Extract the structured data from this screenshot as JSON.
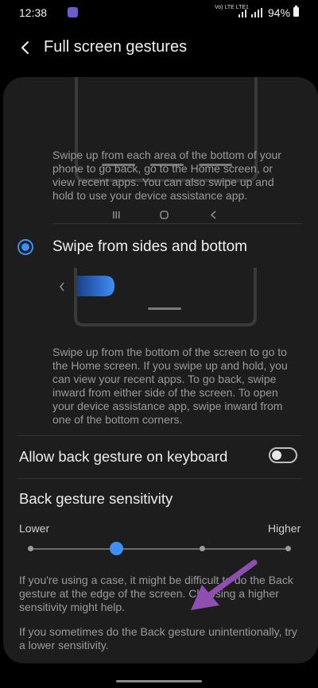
{
  "status_bar": {
    "time": "12:38",
    "network": "Vo) LTE LTE1",
    "battery": "94%"
  },
  "header": {
    "title": "Full screen gestures"
  },
  "option_buttons": {
    "description": "Swipe up from each area of the bottom of your phone to go back, go to the Home screen, or view recent apps. You can also swipe up and hold to use your device assistance app."
  },
  "option_gestures": {
    "label": "Swipe from sides and bottom",
    "selected": true,
    "description": "Swipe up from the bottom of the screen to go to the Home screen. If you swipe up and hold, you can view your recent apps. To go back, swipe inward from either side of the screen. To open your device assistance app, swipe inward from one of the bottom corners."
  },
  "keyboard_back_gesture": {
    "label": "Allow back gesture on keyboard",
    "enabled": false
  },
  "sensitivity": {
    "title": "Back gesture sensitivity",
    "min_label": "Lower",
    "max_label": "Higher",
    "steps": 4,
    "value_index": 1,
    "help_1": "If you're using a case, it might be difficult to do the Back gesture at the edge of the screen. Choosing a higher sensitivity might help.",
    "help_2": "If you sometimes do the Back gesture unintentionally, try a lower sensitivity."
  },
  "colors": {
    "accent": "#3f8ef5",
    "annotation_arrow": "#8e4fb0"
  }
}
